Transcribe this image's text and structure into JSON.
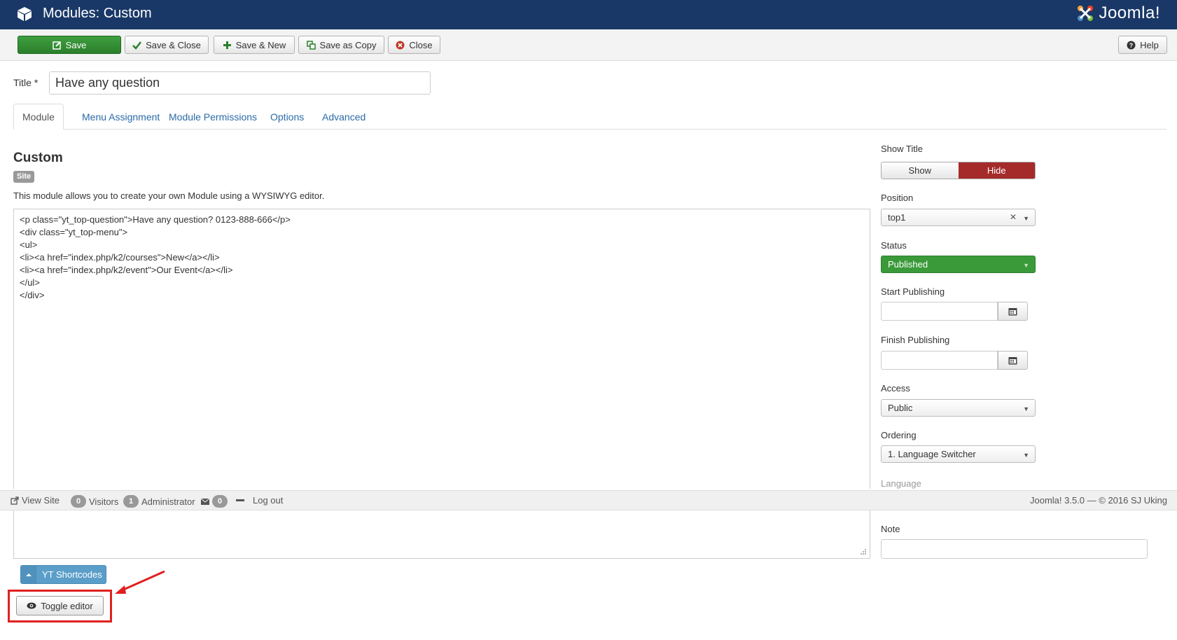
{
  "header": {
    "title": "Modules: Custom",
    "logo_text": "Joomla!"
  },
  "toolbar": {
    "save_label": "Save",
    "save_close_label": "Save & Close",
    "save_new_label": "Save & New",
    "save_copy_label": "Save as Copy",
    "close_label": "Close",
    "help_label": "Help"
  },
  "form": {
    "title_label": "Title *",
    "title_value": "Have any question"
  },
  "tabs": [
    {
      "label": "Module",
      "active": true
    },
    {
      "label": "Menu Assignment",
      "active": false
    },
    {
      "label": "Module Permissions",
      "active": false
    },
    {
      "label": "Options",
      "active": false
    },
    {
      "label": "Advanced",
      "active": false
    }
  ],
  "module": {
    "heading": "Custom",
    "badge": "Site",
    "description": "This module allows you to create your own Module using a WYSIWYG editor.",
    "code_lines": [
      "<p class=\"yt_top-question\">Have any question? 0123-888-666</p>",
      "<div class=\"yt_top-menu\">",
      "<ul>",
      "<li><a href=\"index.php/k2/courses\">New</a></li>",
      "<li><a href=\"index.php/k2/event\">Our Event</a></li>",
      "</ul>",
      "</div>"
    ],
    "shortcodes_label": "YT Shortcodes",
    "toggle_editor_label": "Toggle editor"
  },
  "sidebar": {
    "show_title_label": "Show Title",
    "show_option": "Show",
    "hide_option": "Hide",
    "position_label": "Position",
    "position_value": "top1",
    "status_label": "Status",
    "status_value": "Published",
    "start_publishing_label": "Start Publishing",
    "finish_publishing_label": "Finish Publishing",
    "access_label": "Access",
    "access_value": "Public",
    "ordering_label": "Ordering",
    "ordering_value": "1. Language Switcher",
    "language_label": "Language",
    "note_label": "Note"
  },
  "statusbar": {
    "view_site": "View Site",
    "visitors_count": "0",
    "visitors_label": "Visitors",
    "admin_count": "1",
    "admin_label": "Administrator",
    "messages_count": "0",
    "logout_label": "Log out",
    "footer_text": "Joomla! 3.5.0 — © 2016 SJ Uking"
  },
  "colors": {
    "header_bg": "#1a3867",
    "save_green": "#2b7f2b",
    "hide_red": "#a52a2a",
    "published_green": "#3a9a3a",
    "highlight_red": "#e02020"
  }
}
